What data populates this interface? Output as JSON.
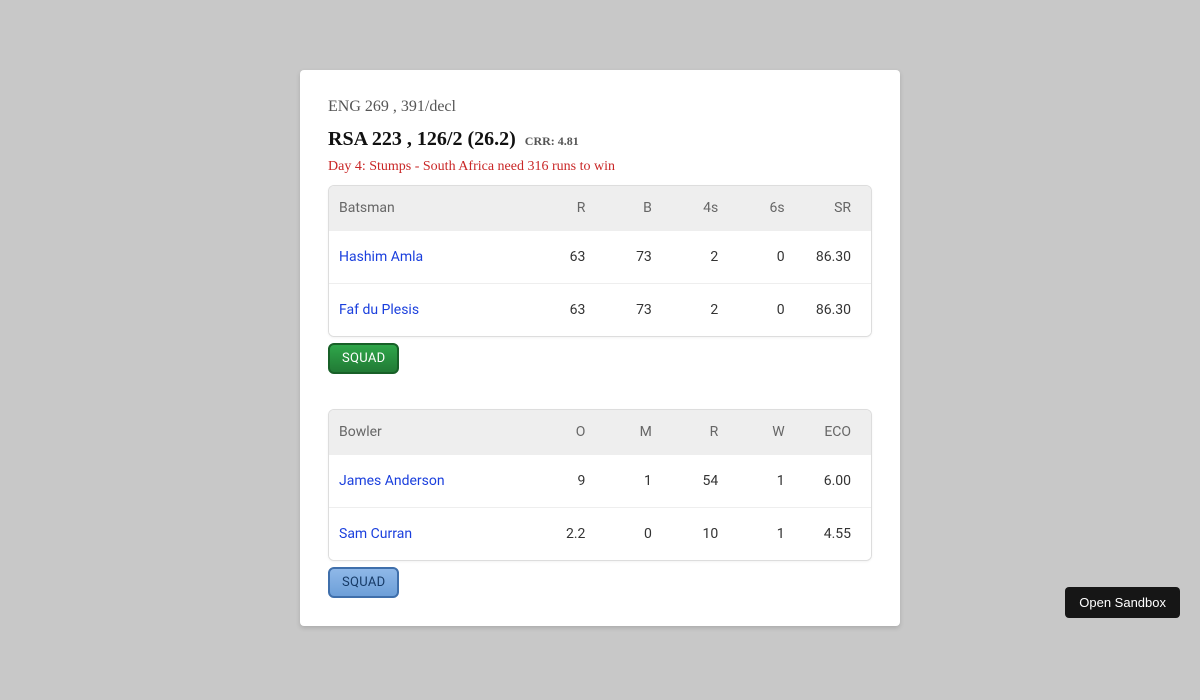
{
  "header": {
    "line1": "ENG 269 , 391/decl",
    "line2_score": "RSA 223 , 126/2 (26.2)",
    "crr_label": "CRR: 4.81",
    "status": "Day 4: Stumps - South Africa need 316 runs to win"
  },
  "batting": {
    "columns": {
      "name": "Batsman",
      "r": "R",
      "b": "B",
      "fours": "4s",
      "sixes": "6s",
      "sr": "SR"
    },
    "rows": [
      {
        "name": "Hashim Amla",
        "r": "63",
        "b": "73",
        "fours": "2",
        "sixes": "0",
        "sr": "86.30"
      },
      {
        "name": "Faf du Plesis",
        "r": "63",
        "b": "73",
        "fours": "2",
        "sixes": "0",
        "sr": "86.30"
      }
    ],
    "squad_label": "SQUAD"
  },
  "bowling": {
    "columns": {
      "name": "Bowler",
      "o": "O",
      "m": "M",
      "r": "R",
      "w": "W",
      "eco": "ECO"
    },
    "rows": [
      {
        "name": "James Anderson",
        "o": "9",
        "m": "1",
        "r": "54",
        "w": "1",
        "eco": "6.00"
      },
      {
        "name": "Sam Curran",
        "o": "2.2",
        "m": "0",
        "r": "10",
        "w": "1",
        "eco": "4.55"
      }
    ],
    "squad_label": "SQUAD"
  },
  "sandbox_label": "Open Sandbox"
}
